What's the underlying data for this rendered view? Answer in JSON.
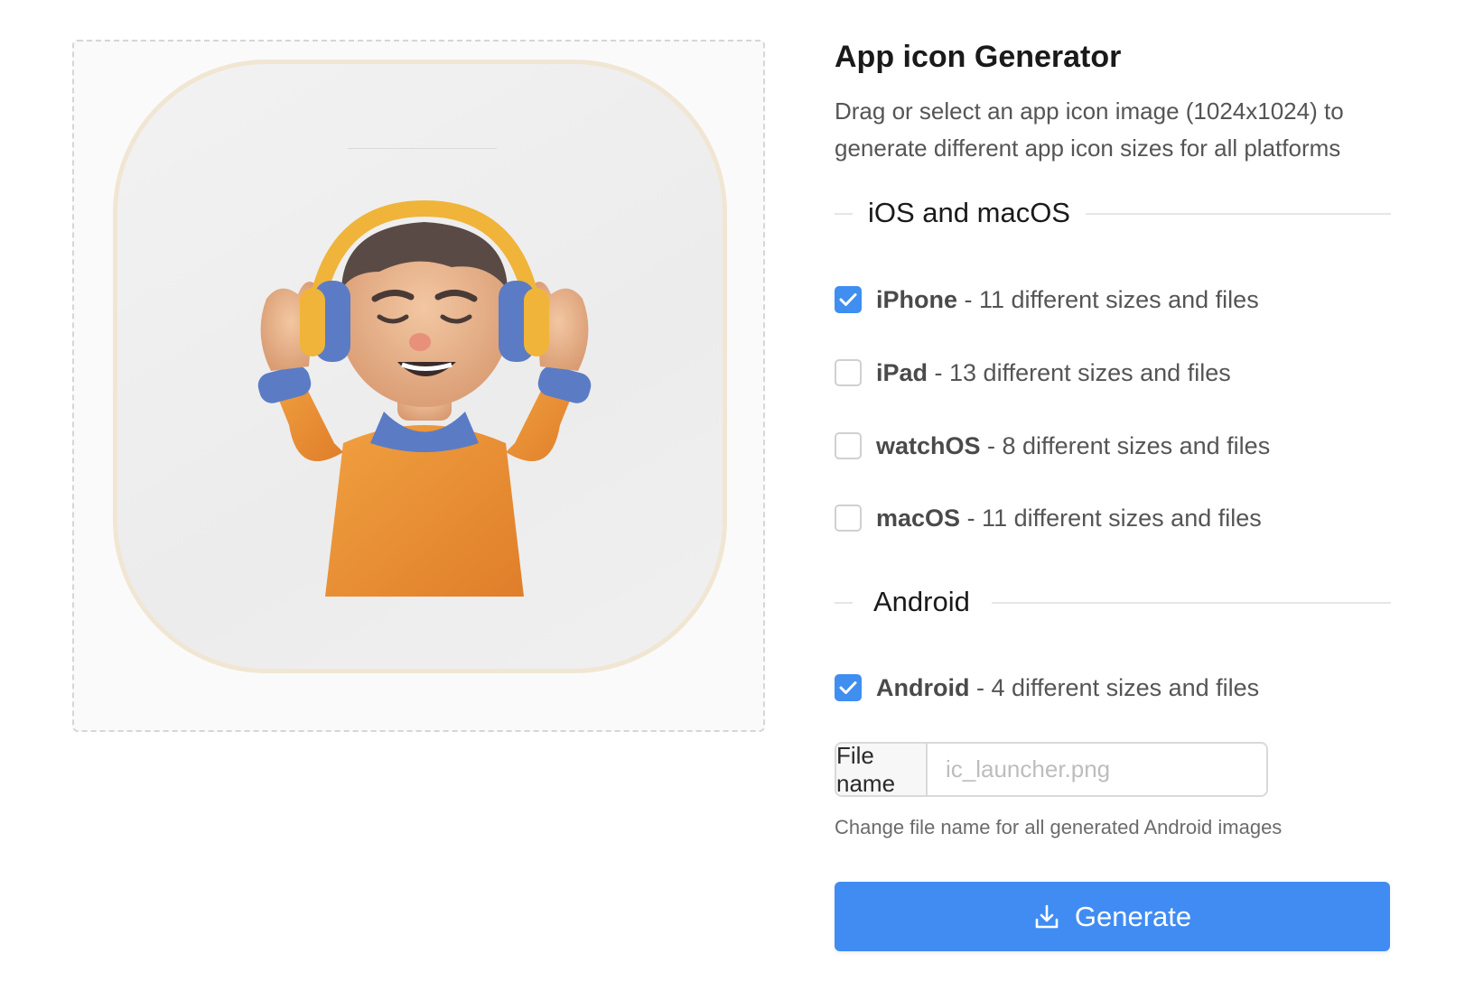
{
  "header": {
    "title": "App icon Generator",
    "description": "Drag or select an app icon image (1024x1024) to generate different app icon sizes for all platforms"
  },
  "sections": {
    "ios": {
      "label": "iOS and macOS",
      "options": [
        {
          "name": "iPhone",
          "detail": " - 11 different sizes and files",
          "checked": true
        },
        {
          "name": "iPad",
          "detail": " - 13 different sizes and files",
          "checked": false
        },
        {
          "name": "watchOS",
          "detail": " - 8 different sizes and files",
          "checked": false
        },
        {
          "name": "macOS",
          "detail": " - 11 different sizes and files",
          "checked": false
        }
      ]
    },
    "android": {
      "label": "Android",
      "options": [
        {
          "name": "Android",
          "detail": " - 4 different sizes and files",
          "checked": true
        }
      ],
      "file_name_label": "File name",
      "file_name_placeholder": "ic_launcher.png",
      "file_name_value": "",
      "hint": "Change file name for all generated Android images"
    }
  },
  "generate": {
    "label": "Generate",
    "icon": "download-icon"
  },
  "preview": {
    "icon": "person-with-headphones-illustration"
  },
  "colors": {
    "accent": "#408cf3",
    "tile_border": "#f1e6d3"
  }
}
